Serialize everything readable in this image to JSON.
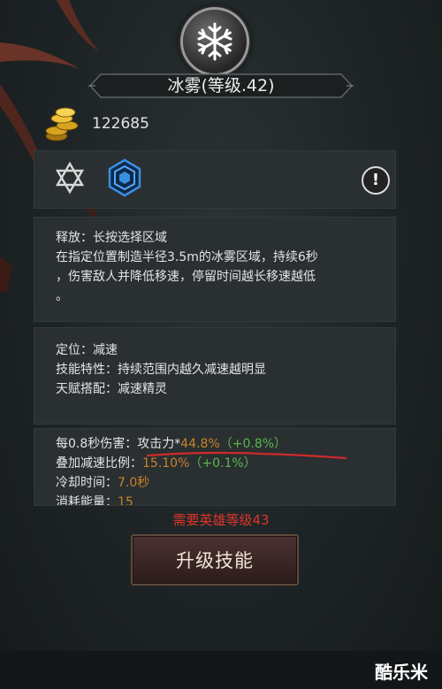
{
  "skill": {
    "title": "冰雾(等级.42)",
    "icon": "snowflake-icon"
  },
  "gold": {
    "amount": "122685",
    "icon": "gold-coins-icon"
  },
  "icons_row": {
    "left_icon": "hexagram-star-icon",
    "middle_icon": "blue-hexagon-gem-icon",
    "right_icon": "info-exclamation-icon",
    "right_label": "!"
  },
  "release": {
    "heading": "释放：长按选择区域",
    "lines": [
      "在指定位置制造半径3.5m的冰雾区域，持续6秒",
      "，伤害敌人并降低移速，停留时间越长移速越低",
      "。"
    ]
  },
  "role": {
    "heading": "定位：减速",
    "feature": "技能特性：持续范围内越久减速越明显",
    "talent": "天赋搭配：减速精灵"
  },
  "stats": {
    "damage_label": "每0.8秒伤害：",
    "damage_prefix": "攻击力*",
    "damage_value": "44.8%",
    "damage_bonus": "（+0.8%）",
    "slow_label": "叠加减速比例：",
    "slow_value": "15.10%",
    "slow_bonus": "（+0.1%）",
    "cooldown_label": "冷却时间：",
    "cooldown_value": "7.0秒",
    "energy_label": "消耗能量：",
    "energy_value": "15"
  },
  "requirement": "需要英雄等级43",
  "upgrade_button": "升级技能",
  "watermark": "酷乐米",
  "colors": {
    "green": "#58b94a",
    "orange": "#c9832a",
    "red": "#e0342a",
    "underline": "#d02a2a"
  }
}
